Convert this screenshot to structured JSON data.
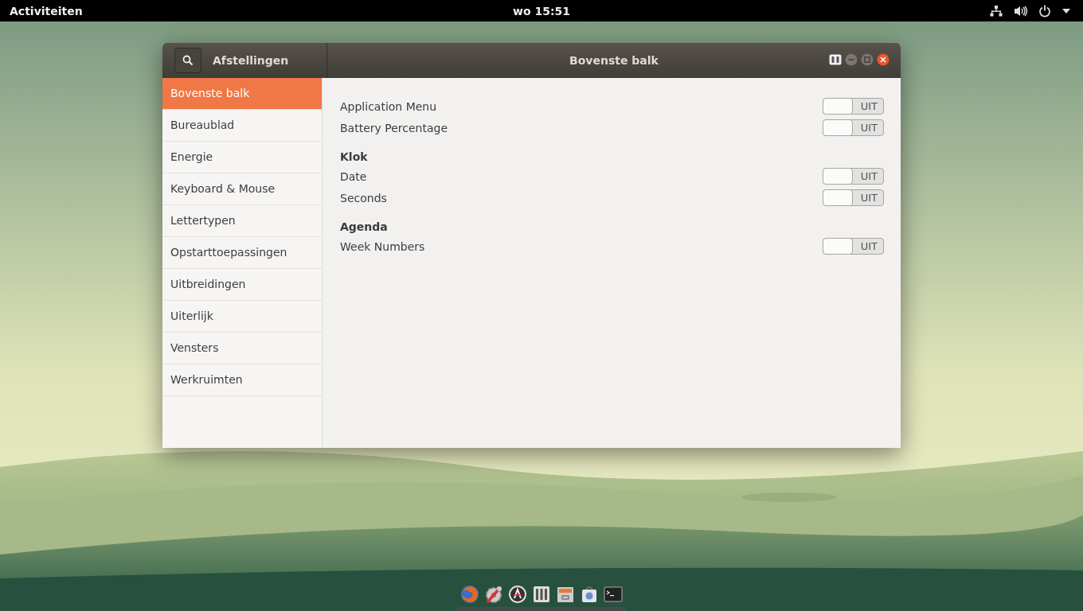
{
  "top_bar": {
    "activities": "Activiteiten",
    "clock": "wo 15:51"
  },
  "window": {
    "app_title": "Afstellingen",
    "title": "Bovenste balk"
  },
  "sidebar": {
    "items": [
      {
        "label": "Bovenste balk",
        "selected": true
      },
      {
        "label": "Bureaublad",
        "selected": false
      },
      {
        "label": "Energie",
        "selected": false
      },
      {
        "label": "Keyboard & Mouse",
        "selected": false
      },
      {
        "label": "Lettertypen",
        "selected": false
      },
      {
        "label": "Opstarttoepassingen",
        "selected": false
      },
      {
        "label": "Uitbreidingen",
        "selected": false
      },
      {
        "label": "Uiterlijk",
        "selected": false
      },
      {
        "label": "Vensters",
        "selected": false
      },
      {
        "label": "Werkruimten",
        "selected": false
      }
    ]
  },
  "groups": [
    {
      "settings": [
        {
          "label": "Application Menu",
          "on": false,
          "state_text": "UIT"
        },
        {
          "label": "Battery Percentage",
          "on": false,
          "state_text": "UIT"
        }
      ]
    },
    {
      "heading": "Klok",
      "settings": [
        {
          "label": "Date",
          "on": false,
          "state_text": "UIT"
        },
        {
          "label": "Seconds",
          "on": false,
          "state_text": "UIT"
        }
      ]
    },
    {
      "heading": "Agenda",
      "settings": [
        {
          "label": "Week Numbers",
          "on": false,
          "state_text": "UIT"
        }
      ]
    }
  ]
}
